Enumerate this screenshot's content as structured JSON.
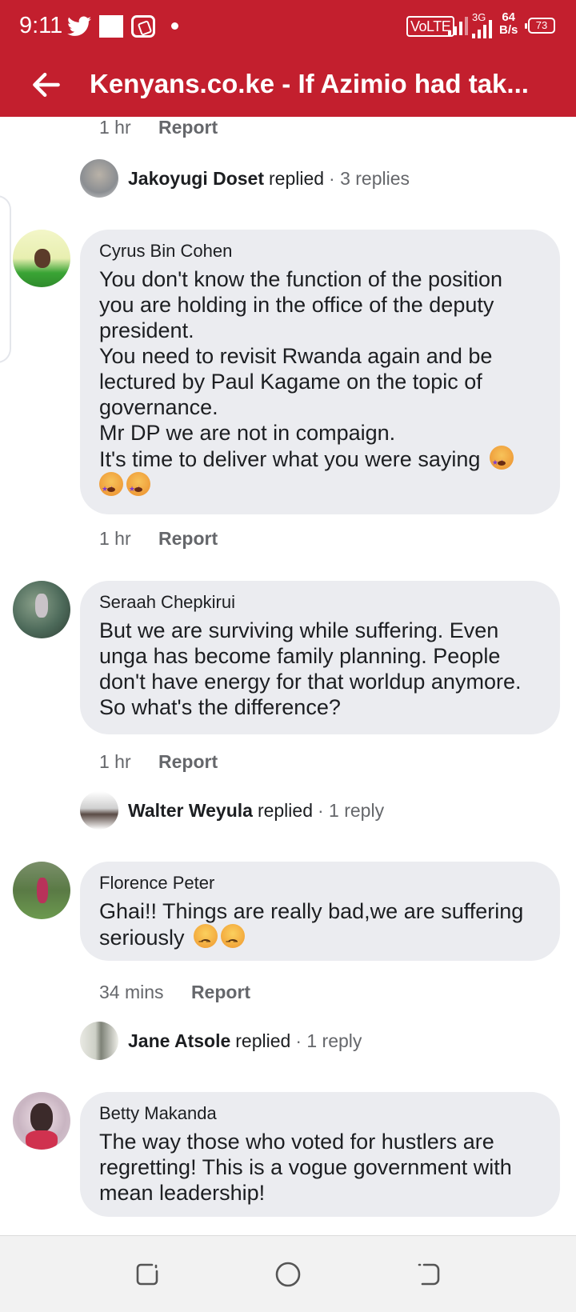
{
  "status_bar": {
    "time": "9:11",
    "volte": "VoLTE",
    "network": "3G",
    "speed_value": "64",
    "speed_unit": "B/s",
    "battery": "73",
    "icons": [
      "twitter-icon",
      "notification-square-icon",
      "app-icon",
      "dot-icon",
      "signal-icon",
      "battery-icon"
    ]
  },
  "header": {
    "title": "Kenyans.co.ke - If Azimio had tak...",
    "back_icon": "arrow-left-icon"
  },
  "feed": {
    "top_meta": {
      "time": "1 hr",
      "report": "Report"
    },
    "threads": [
      {
        "replied_by": "Jakoyugi Doset",
        "replied_word": "replied",
        "reply_count": "· 3 replies",
        "comment": {
          "author": "Cyrus Bin Cohen",
          "text": "You don't know the function of the position you are holding in the office of the deputy president.\nYou need to revisit Rwanda again and be lectured by Paul Kagame on the topic of governance.\nMr DP we are not in compaign.\nIt's time to deliver what you were saying",
          "time": "1 hr",
          "report": "Report"
        }
      },
      {
        "comment": {
          "author": "Seraah Chepkirui",
          "text": "But we are surviving while suffering. Even unga has become family planning. People don't have energy for that worldup anymore. So what's the difference?",
          "time": "1 hr",
          "report": "Report"
        }
      },
      {
        "replied_by": "Walter Weyula",
        "replied_word": "replied",
        "reply_count": "· 1 reply",
        "comment": {
          "author": "Florence Peter",
          "text": "Ghai!! Things are really bad,we are suffering seriously",
          "time": "34 mins",
          "report": "Report"
        }
      },
      {
        "replied_by": "Jane Atsole",
        "replied_word": "replied",
        "reply_count": "· 1 reply",
        "comment": {
          "author": "Betty Makanda",
          "text": "The way those who voted for hustlers are regretting! This is a vogue government with mean leadership!"
        }
      }
    ]
  },
  "nav_bar": {
    "icons": [
      "recents-icon",
      "home-icon",
      "back-icon"
    ]
  },
  "colors": {
    "brand_red": "#c31f2e",
    "bubble": "#ebecf0",
    "meta_gray": "#65676b"
  }
}
